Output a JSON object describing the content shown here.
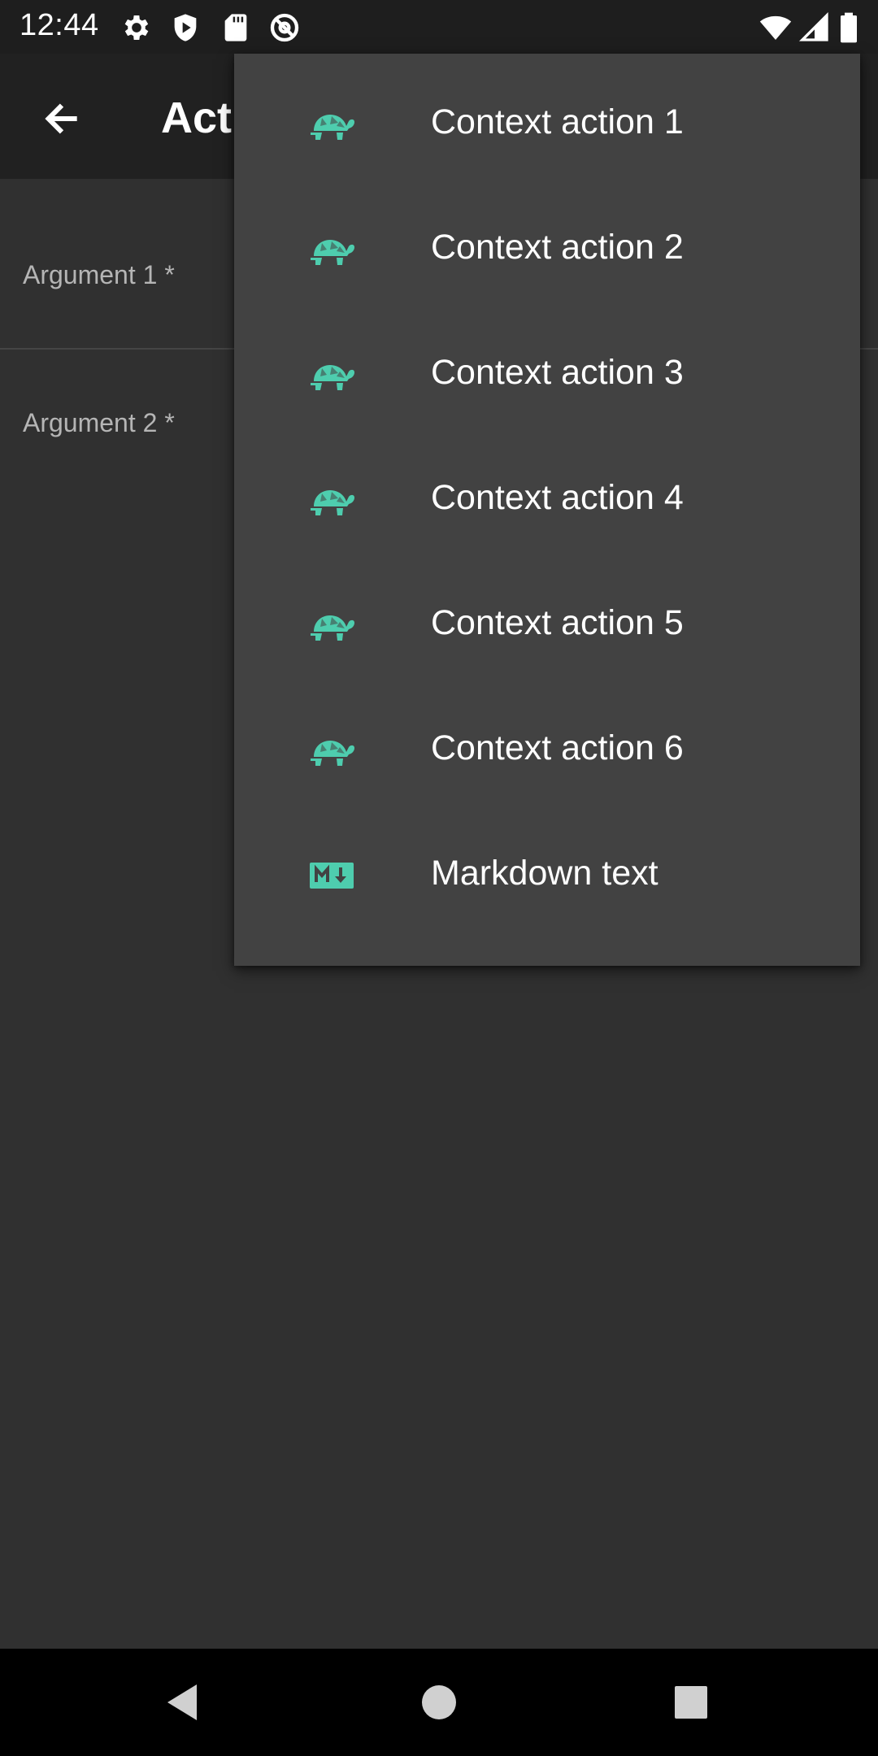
{
  "status_bar": {
    "time": "12:44",
    "left_icons": [
      "gear-icon",
      "shield-icon",
      "sd-card-icon",
      "at-sign-icon"
    ],
    "right_icons": [
      "wifi-icon",
      "cell-signal-icon",
      "battery-icon"
    ]
  },
  "app_bar": {
    "back_icon": "arrow-left-icon",
    "title": "Acti"
  },
  "form": {
    "fields": [
      {
        "label": "Argument 1 *"
      },
      {
        "label": "Argument 2 *"
      }
    ]
  },
  "menu": {
    "accent_color": "#4ecdae",
    "items": [
      {
        "label": "Context action 1",
        "icon": "turtle-icon"
      },
      {
        "label": "Context action 2",
        "icon": "turtle-icon"
      },
      {
        "label": "Context action 3",
        "icon": "turtle-icon"
      },
      {
        "label": "Context action 4",
        "icon": "turtle-icon"
      },
      {
        "label": "Context action 5",
        "icon": "turtle-icon"
      },
      {
        "label": "Context action 6",
        "icon": "turtle-icon"
      },
      {
        "label": "Markdown text",
        "icon": "markdown-icon"
      }
    ]
  },
  "nav_bar": {
    "buttons": [
      "back-triangle-icon",
      "home-circle-icon",
      "recents-square-icon"
    ]
  }
}
